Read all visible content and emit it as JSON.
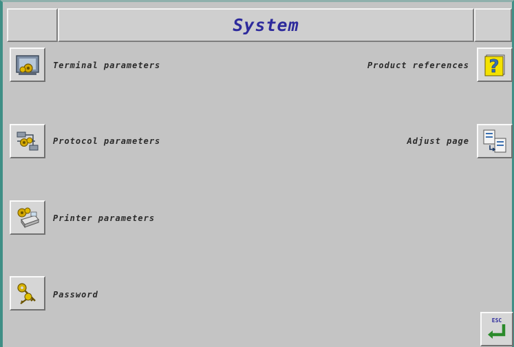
{
  "window": {
    "title": "System"
  },
  "menu": {
    "terminal_parameters": {
      "label": "Terminal parameters",
      "icon": "terminal-settings-icon"
    },
    "protocol_parameters": {
      "label": "Protocol parameters",
      "icon": "protocol-settings-icon"
    },
    "printer_parameters": {
      "label": "Printer parameters",
      "icon": "printer-settings-icon"
    },
    "password": {
      "label": "Password",
      "icon": "keys-icon"
    },
    "product_references": {
      "label": "Product references",
      "icon": "question-icon"
    },
    "adjust_page": {
      "label": "Adjust page",
      "icon": "adjust-page-icon"
    }
  },
  "esc_button": {
    "label": "ESC",
    "icon": "return-arrow-icon"
  },
  "colors": {
    "background": "#c4c4c4",
    "title": "#2d2a9c",
    "frame": "#3f8f86"
  }
}
